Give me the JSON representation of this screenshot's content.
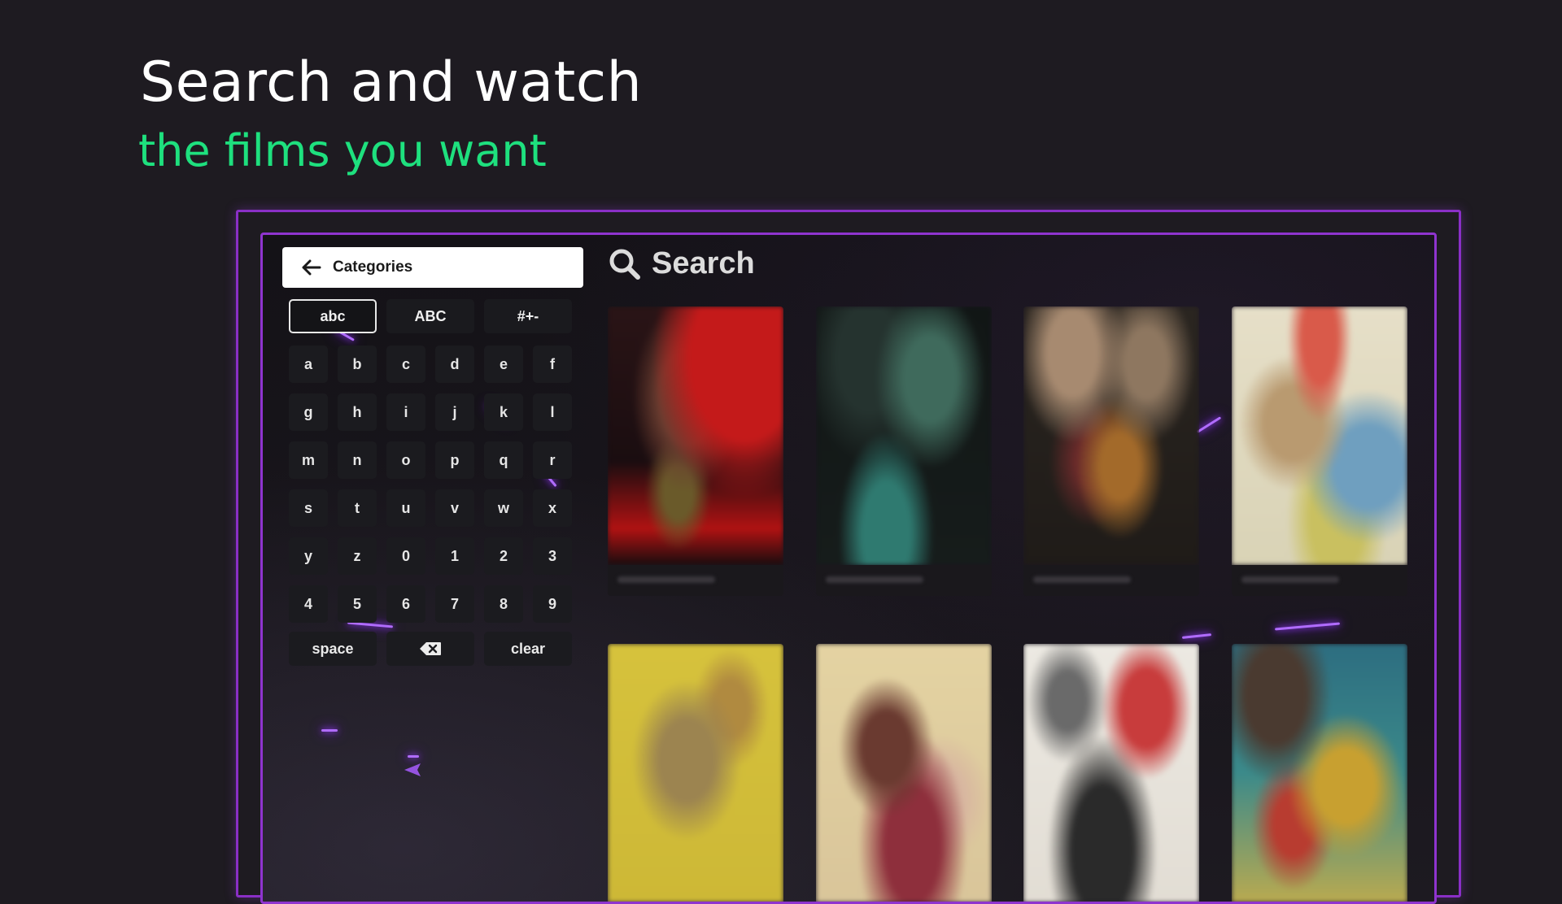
{
  "hero": {
    "title": "Search and watch",
    "subtitle": "the films you want"
  },
  "colors": {
    "background": "#1e1b21",
    "accent_green": "#1ee07e",
    "frame_purple": "#8a2fc6"
  },
  "sidebar": {
    "categories_label": "Categories",
    "back_icon": "arrow-left-icon"
  },
  "keyboard": {
    "modes": [
      "abc",
      "ABC",
      "#+-"
    ],
    "active_mode": "abc",
    "keys": [
      "a",
      "b",
      "c",
      "d",
      "e",
      "f",
      "g",
      "h",
      "i",
      "j",
      "k",
      "l",
      "m",
      "n",
      "o",
      "p",
      "q",
      "r",
      "s",
      "t",
      "u",
      "v",
      "w",
      "x",
      "y",
      "z",
      "0",
      "1",
      "2",
      "3",
      "4",
      "5",
      "6",
      "7",
      "8",
      "9"
    ],
    "space_label": "space",
    "backspace_icon": "backspace-icon",
    "clear_label": "clear"
  },
  "search": {
    "label": "Search",
    "icon": "search-icon"
  },
  "results": {
    "posters": [
      {
        "icon": "movie-poster-1"
      },
      {
        "icon": "movie-poster-2"
      },
      {
        "icon": "movie-poster-3"
      },
      {
        "icon": "movie-poster-4"
      },
      {
        "icon": "movie-poster-5"
      },
      {
        "icon": "movie-poster-6"
      },
      {
        "icon": "movie-poster-7"
      },
      {
        "icon": "movie-poster-8"
      }
    ]
  }
}
